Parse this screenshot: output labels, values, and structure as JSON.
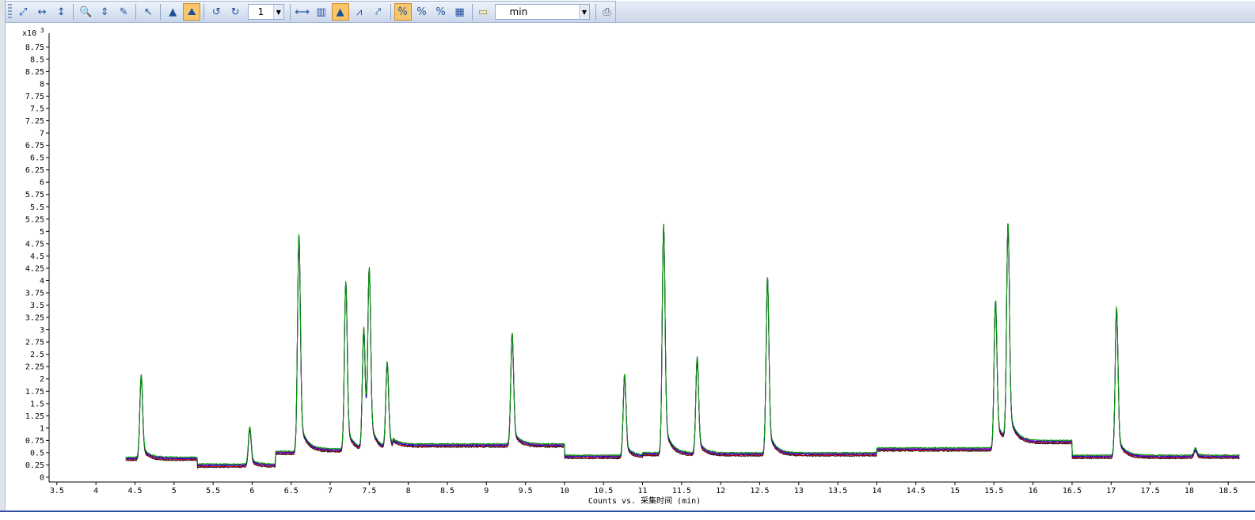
{
  "toolbar": {
    "zoom_value": "1",
    "unit_value": "min",
    "buttons": [
      {
        "icon": "expand-icon",
        "glyph": "⤢",
        "active": false
      },
      {
        "icon": "fit-horizontal-icon",
        "glyph": "↔",
        "active": false
      },
      {
        "icon": "fit-vertical-icon",
        "glyph": "↕",
        "active": false
      },
      {
        "icon": "zoom-out-icon",
        "glyph": "🔍",
        "active": false
      },
      {
        "icon": "autoscale-y-icon",
        "glyph": "⇕",
        "active": false
      },
      {
        "icon": "peak-label-icon",
        "glyph": "✎",
        "active": false
      },
      {
        "icon": "cursor-icon",
        "glyph": "↖",
        "active": false
      },
      {
        "icon": "integrate-icon",
        "glyph": "▲",
        "active": false
      },
      {
        "icon": "overlay-peaks-icon",
        "glyph": "⛰",
        "active": true
      },
      {
        "icon": "undo-icon",
        "glyph": "↺",
        "active": false
      },
      {
        "icon": "redo-icon",
        "glyph": "↻",
        "active": false
      }
    ],
    "buttons2": [
      {
        "icon": "range-icon",
        "glyph": "⟷",
        "active": false
      },
      {
        "icon": "bar-peak-icon",
        "glyph": "▥",
        "active": false
      },
      {
        "icon": "peak-active-icon",
        "glyph": "▲",
        "active": true
      },
      {
        "icon": "peak-spread-icon",
        "glyph": "⩘",
        "active": false
      },
      {
        "icon": "link-icon",
        "glyph": "⤤",
        "active": false
      }
    ],
    "buttons3": [
      {
        "icon": "percent-off-icon",
        "glyph": "%",
        "active": true
      },
      {
        "icon": "percent-icon",
        "glyph": "%",
        "active": false
      },
      {
        "icon": "percent-stack-icon",
        "glyph": "%",
        "active": false
      },
      {
        "icon": "grid-icon",
        "glyph": "▦",
        "active": false
      }
    ],
    "palette_icon": "palette-icon",
    "print_icon": "print-icon"
  },
  "chart_data": {
    "type": "line",
    "y_exponent_label": "x10 3",
    "xlabel": "Counts vs. 采集时间 (min)",
    "xlim": [
      3.4,
      18.65
    ],
    "ylim": [
      0,
      8.9
    ],
    "x_ticks": [
      "3.5",
      "4",
      "4.5",
      "5",
      "5.5",
      "6",
      "6.5",
      "7",
      "7.5",
      "8",
      "8.5",
      "9",
      "9.5",
      "10",
      "10.5",
      "11",
      "11.5",
      "12",
      "12.5",
      "13",
      "13.5",
      "14",
      "14.5",
      "15",
      "15.5",
      "16",
      "16.5",
      "17",
      "17.5",
      "18",
      "18.5"
    ],
    "y_ticks": [
      "0",
      "0.25",
      "0.5",
      "0.75",
      "1",
      "1.25",
      "1.5",
      "1.75",
      "2",
      "2.25",
      "2.5",
      "2.75",
      "3",
      "3.25",
      "3.5",
      "3.75",
      "4",
      "4.25",
      "4.5",
      "4.75",
      "5",
      "5.25",
      "5.5",
      "5.75",
      "6",
      "6.25",
      "6.5",
      "6.75",
      "7",
      "7.25",
      "7.5",
      "7.75",
      "8",
      "8.25",
      "8.5",
      "8.75"
    ],
    "baseline_segments": [
      {
        "x0": 4.38,
        "x1": 5.3,
        "y": 0.38
      },
      {
        "x0": 5.3,
        "x1": 6.3,
        "y": 0.24
      },
      {
        "x0": 6.3,
        "x1": 6.55,
        "y": 0.5
      },
      {
        "x0": 6.55,
        "x1": 7.8,
        "y": 0.55
      },
      {
        "x0": 7.8,
        "x1": 10.0,
        "y": 0.65
      },
      {
        "x0": 10.0,
        "x1": 11.0,
        "y": 0.42
      },
      {
        "x0": 11.0,
        "x1": 14.0,
        "y": 0.47
      },
      {
        "x0": 14.0,
        "x1": 15.5,
        "y": 0.57
      },
      {
        "x0": 15.5,
        "x1": 16.5,
        "y": 0.72
      },
      {
        "x0": 16.5,
        "x1": 18.65,
        "y": 0.42
      }
    ],
    "peaks": [
      {
        "x": 4.58,
        "y": 2.07
      },
      {
        "x": 5.97,
        "y": 1.0
      },
      {
        "x": 6.6,
        "y": 4.95
      },
      {
        "x": 7.2,
        "y": 3.98
      },
      {
        "x": 7.43,
        "y": 3.0
      },
      {
        "x": 7.5,
        "y": 4.1
      },
      {
        "x": 7.73,
        "y": 2.3
      },
      {
        "x": 9.33,
        "y": 2.93
      },
      {
        "x": 10.77,
        "y": 2.08
      },
      {
        "x": 11.27,
        "y": 5.15
      },
      {
        "x": 11.7,
        "y": 2.43
      },
      {
        "x": 12.6,
        "y": 4.08
      },
      {
        "x": 15.52,
        "y": 3.6
      },
      {
        "x": 15.68,
        "y": 5.13
      },
      {
        "x": 17.07,
        "y": 3.45
      },
      {
        "x": 18.08,
        "y": 0.57
      }
    ],
    "series": [
      {
        "color": "#00a000",
        "offset": 0.03
      },
      {
        "color": "#0000cc",
        "offset": 0.0
      },
      {
        "color": "#cc0000",
        "offset": -0.02
      },
      {
        "color": "#cc00cc",
        "offset": 0.015
      },
      {
        "color": "#111111",
        "offset": -0.035
      }
    ]
  }
}
